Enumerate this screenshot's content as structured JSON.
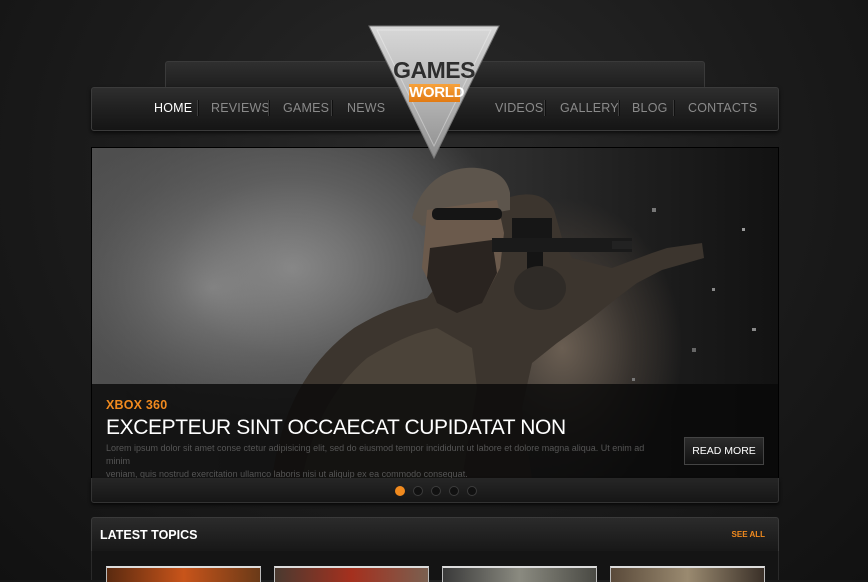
{
  "logo": {
    "line1": "GAMES",
    "line2": "WORLD"
  },
  "nav": {
    "left": [
      "HOME",
      "REVIEWS",
      "GAMES",
      "NEWS"
    ],
    "right": [
      "VIDEOS",
      "GALLERY",
      "BLOG",
      "CONTACTS"
    ],
    "active": "HOME"
  },
  "slider": {
    "category": "XBOX 360",
    "title": "EXCEPTEUR SINT OCCAECAT CUPIDATAT NON",
    "body_line1": "Lorem ipsum dolor sit amet conse ctetur adipisicing elit, sed do eiusmod tempor incididunt ut labore et dolore magna aliqua. Ut enim ad minim",
    "body_line2": "veniam, quis nostrud exercitation ullamco laboris nisi ut aliquip ex ea commodo consequat.",
    "read_more": "READ MORE",
    "slide_count": 5,
    "active_slide": 1
  },
  "latest": {
    "title": "LATEST TOPICS",
    "see_all": "SEE ALL"
  },
  "colors": {
    "accent": "#f18a1e",
    "background": "#1b1b1b",
    "text": "#ffffff",
    "muted": "#8a8a8a"
  }
}
